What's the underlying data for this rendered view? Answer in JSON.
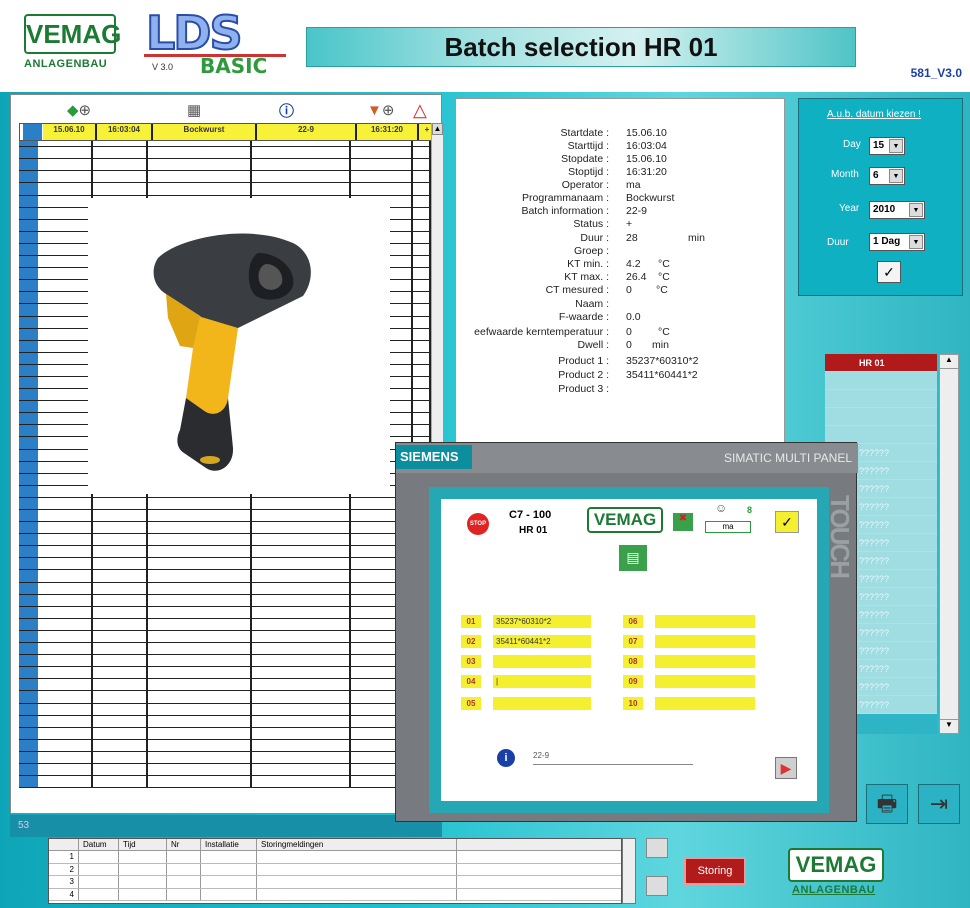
{
  "header": {
    "vemag_logo": "VEMAG",
    "vemag_sub": "ANLAGENBAU",
    "lds_logo": "LDS",
    "lds_version": "V 3.0",
    "lds_basic": "BASIC",
    "title": "Batch selection HR 01",
    "version": "581_V3.0"
  },
  "grid": {
    "selected_row": [
      "15.06.10",
      "16:03:04",
      "Bockwurst",
      "22-9",
      "16:31:20",
      "+"
    ],
    "status_count": "53"
  },
  "detail": {
    "rows": [
      {
        "label": "Startdate :",
        "value": "15.06.10"
      },
      {
        "label": "Starttijd :",
        "value": "16:03:04"
      },
      {
        "label": "Stopdate :",
        "value": "15.06.10"
      },
      {
        "label": "Stoptijd :",
        "value": "16:31:20"
      },
      {
        "label": "Operator :",
        "value": "ma"
      },
      {
        "label": "Programmanaam :",
        "value": "Bockwurst"
      },
      {
        "label": "Batch information :",
        "value": "22-9"
      },
      {
        "label": "Status :",
        "value": "+"
      },
      {
        "label": "Duur :",
        "value": "28"
      },
      {
        "label": "Groep :",
        "value": ""
      },
      {
        "label": "KT min. :",
        "value": "4.2"
      },
      {
        "label": "KT max. :",
        "value": "26.4"
      },
      {
        "label": "CT mesured :",
        "value": "0"
      },
      {
        "label": "Naam :",
        "value": ""
      },
      {
        "label": "F-waarde :",
        "value": "0.0"
      },
      {
        "label": "eefwaarde kerntemperatuur :",
        "value": "0"
      },
      {
        "label": "Dwell :",
        "value": "0"
      },
      {
        "label": "Product 1 :",
        "value": "35237*60310*2"
      },
      {
        "label": "Product 2 :",
        "value": "35411*60441*2"
      },
      {
        "label": "Product 3 :",
        "value": ""
      }
    ],
    "unit_min": "min",
    "unit_c": "°C",
    "unit_min2": "min"
  },
  "datepicker": {
    "title": "A.u.b. datum kiezen !",
    "day_label": "Day",
    "day_value": "15",
    "month_label": "Month",
    "month_value": "6",
    "year_label": "Year",
    "year_value": "2010",
    "duur_label": "Duur",
    "duur_value": "1 Dag"
  },
  "installations": {
    "items": [
      "HR 01",
      "",
      "",
      "",
      "",
      "??????",
      "??????",
      "??????",
      "??????",
      "??????",
      "??????",
      "??????",
      "??????",
      "??????",
      "??????",
      "??????",
      "??????",
      "??????",
      "??????",
      "??????"
    ]
  },
  "siemens": {
    "brand": "SIEMENS",
    "model": "SIMATIC MULTI PANEL",
    "touch": "TOUCH",
    "hmi": {
      "stop": "STOP",
      "machine": "C7 - 100",
      "unit": "HR 01",
      "vemag": "VEMAG",
      "operator_count": "8",
      "operator_name": "ma",
      "left_nums": [
        "01",
        "02",
        "03",
        "04",
        "05"
      ],
      "left_vals": [
        "35237*60310*2",
        "35411*60441*2",
        "",
        "|",
        ""
      ],
      "right_nums": [
        "06",
        "07",
        "08",
        "09",
        "10"
      ],
      "info_value": "22-9"
    }
  },
  "messages": {
    "headers": [
      "",
      "Datum",
      "Tijd",
      "Nr",
      "Installatie",
      "Storingmeldingen"
    ],
    "rows": [
      "1",
      "2",
      "3",
      "4"
    ]
  },
  "footer": {
    "storing_label": "Storing",
    "vemag": "VEMAG",
    "vemag_sub": "ANLAGENBAU"
  },
  "colors": {
    "brand_green": "#1c7a33",
    "cyan_bg": "#1ec0cf",
    "alert_red": "#b11b1b",
    "field_yellow": "#f4f02f"
  }
}
